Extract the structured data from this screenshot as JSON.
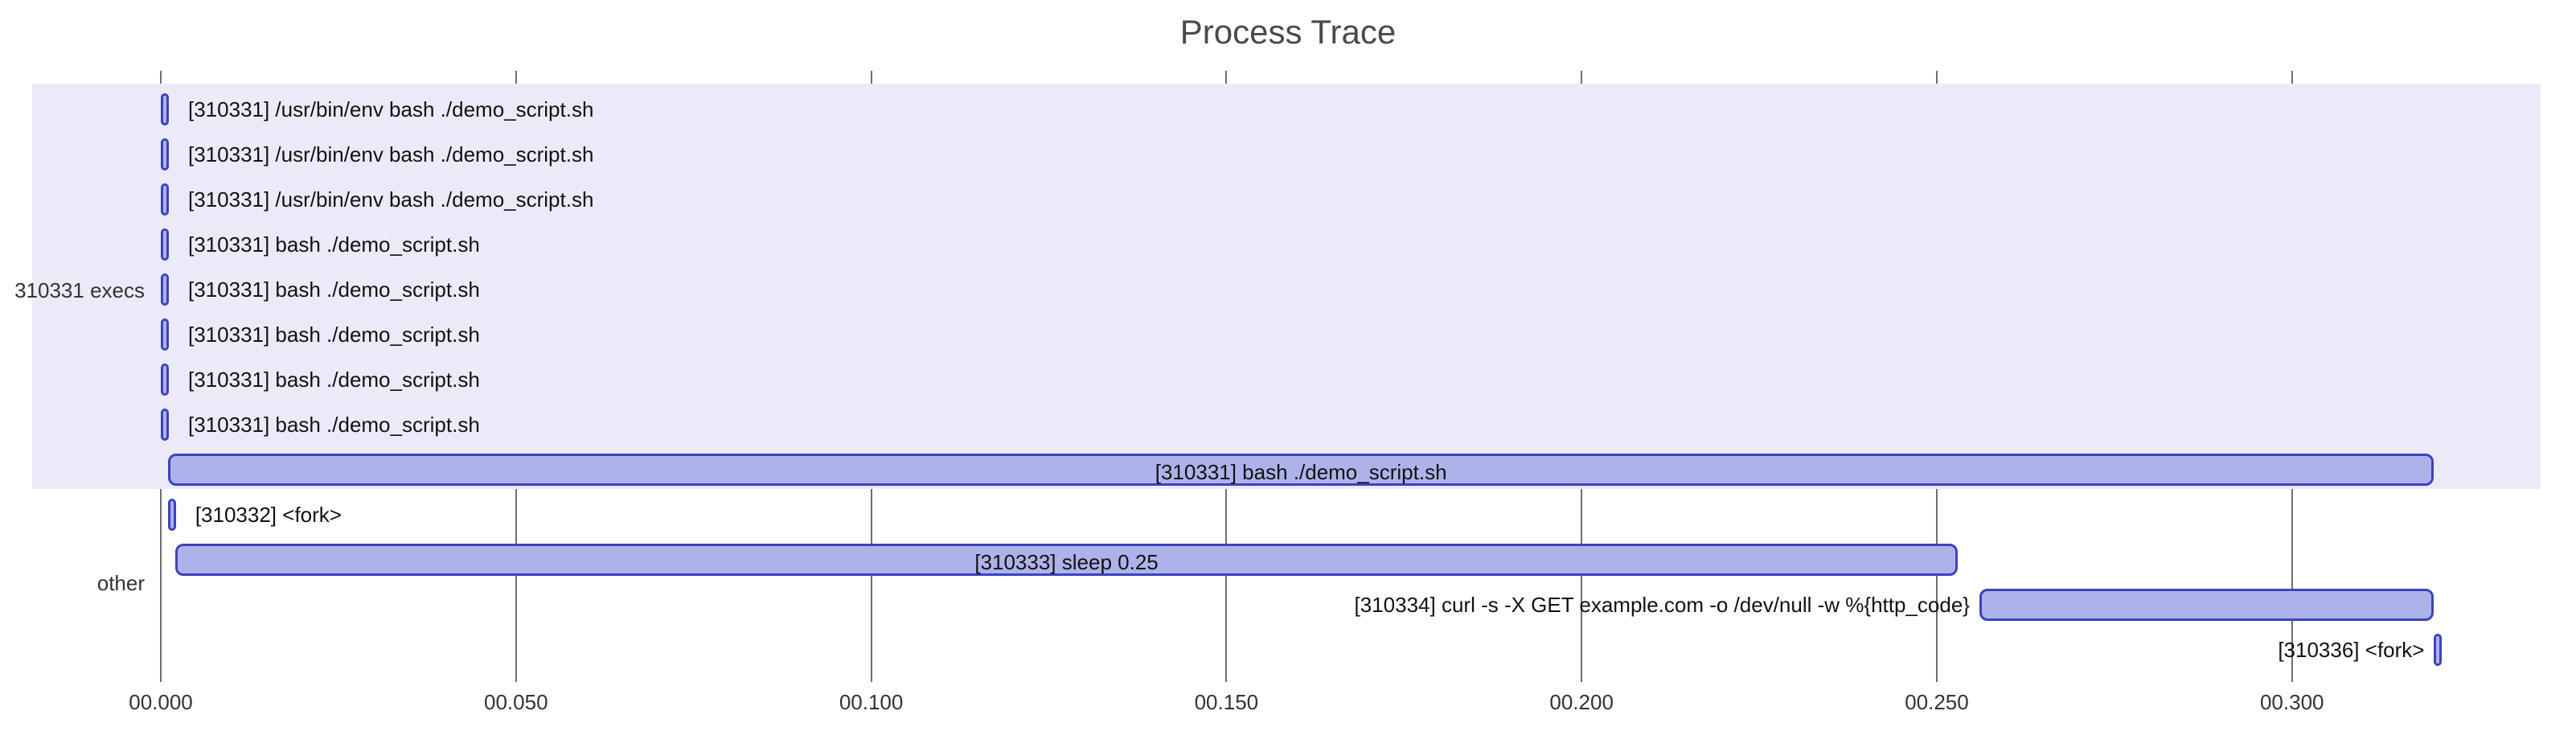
{
  "title": "Process Trace",
  "colors": {
    "bar_fill": "#aeb2ea",
    "bar_stroke": "#3c43c0",
    "band": "#eceaf9",
    "grid": "#555555"
  },
  "chart_data": {
    "type": "bar",
    "xlabel": "",
    "ylabel": "",
    "xlim": [
      0.0,
      0.335
    ],
    "x_ticks": [
      0.0,
      0.05,
      0.1,
      0.15,
      0.2,
      0.25,
      0.3
    ],
    "x_tick_labels": [
      "00.000",
      "00.050",
      "00.100",
      "00.150",
      "00.200",
      "00.250",
      "00.300"
    ],
    "lanes": [
      {
        "id": "310331 execs",
        "label": "310331 execs"
      },
      {
        "id": "other",
        "label": "other"
      }
    ],
    "series": [
      {
        "lane": "310331 execs",
        "row": 0,
        "start": 0.0,
        "end": 0.001,
        "label": "[310331] /usr/bin/env bash ./demo_script.sh",
        "label_pos": "right"
      },
      {
        "lane": "310331 execs",
        "row": 1,
        "start": 0.0,
        "end": 0.001,
        "label": "[310331] /usr/bin/env bash ./demo_script.sh",
        "label_pos": "right"
      },
      {
        "lane": "310331 execs",
        "row": 2,
        "start": 0.0,
        "end": 0.001,
        "label": "[310331] /usr/bin/env bash ./demo_script.sh",
        "label_pos": "right"
      },
      {
        "lane": "310331 execs",
        "row": 3,
        "start": 0.0,
        "end": 0.001,
        "label": "[310331] bash ./demo_script.sh",
        "label_pos": "right"
      },
      {
        "lane": "310331 execs",
        "row": 4,
        "start": 0.0,
        "end": 0.001,
        "label": "[310331] bash ./demo_script.sh",
        "label_pos": "right"
      },
      {
        "lane": "310331 execs",
        "row": 5,
        "start": 0.0,
        "end": 0.001,
        "label": "[310331] bash ./demo_script.sh",
        "label_pos": "right"
      },
      {
        "lane": "310331 execs",
        "row": 6,
        "start": 0.0,
        "end": 0.001,
        "label": "[310331] bash ./demo_script.sh",
        "label_pos": "right"
      },
      {
        "lane": "310331 execs",
        "row": 7,
        "start": 0.0,
        "end": 0.001,
        "label": "[310331] bash ./demo_script.sh",
        "label_pos": "right"
      },
      {
        "lane": "310331 execs",
        "row": 8,
        "start": 0.001,
        "end": 0.32,
        "label": "[310331] bash ./demo_script.sh",
        "label_pos": "inside"
      },
      {
        "lane": "other",
        "row": 0,
        "start": 0.001,
        "end": 0.002,
        "label": "[310332] <fork>",
        "label_pos": "right"
      },
      {
        "lane": "other",
        "row": 1,
        "start": 0.002,
        "end": 0.253,
        "label": "[310333] sleep 0.25",
        "label_pos": "inside"
      },
      {
        "lane": "other",
        "row": 2,
        "start": 0.256,
        "end": 0.32,
        "label": "[310334] curl -s -X GET example.com -o /dev/null -w %{http_code}",
        "label_pos": "left"
      },
      {
        "lane": "other",
        "row": 3,
        "start": 0.32,
        "end": 0.321,
        "label": "[310336] <fork>",
        "label_pos": "left"
      }
    ]
  }
}
